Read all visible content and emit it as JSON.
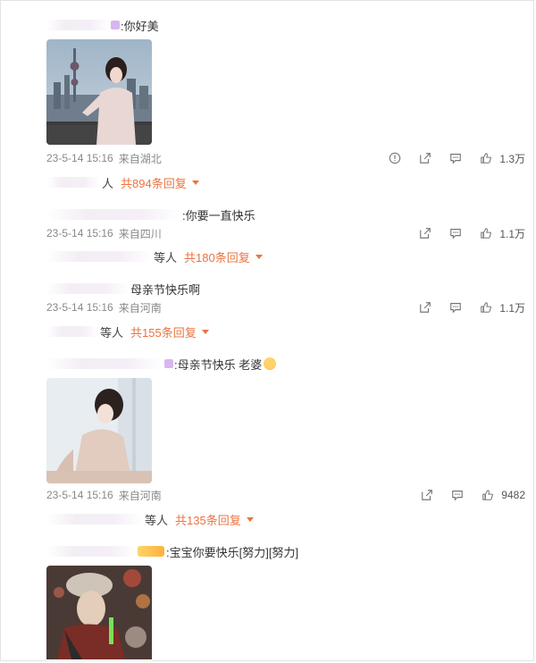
{
  "comments": [
    {
      "text": ":你好美",
      "time": "23-5-14 15:16",
      "location": "来自湖北",
      "likes": "1.3万",
      "reply_prefix": "人",
      "reply_count": "共894条回复"
    },
    {
      "text": ":你要一直快乐",
      "time": "23-5-14 15:16",
      "location": "来自四川",
      "likes": "1.1万",
      "reply_prefix": "等人",
      "reply_count": "共180条回复"
    },
    {
      "text": "母亲节快乐啊",
      "time": "23-5-14 15:16",
      "location": "来自河南",
      "likes": "1.1万",
      "reply_prefix": "等人",
      "reply_count": "共155条回复"
    },
    {
      "text": ":母亲节快乐 老婆",
      "time": "23-5-14 15:16",
      "location": "来自河南",
      "likes": "9482",
      "reply_prefix": "等人",
      "reply_count": "共135条回复"
    },
    {
      "text": ":宝宝你要快乐[努力][努力]"
    }
  ],
  "icons": {
    "report": "warning-icon",
    "share": "share-icon",
    "comment": "comment-icon",
    "like": "thumbs-up-icon"
  },
  "colors": {
    "accent": "#eb7340",
    "meta": "#888888",
    "text": "#333333"
  }
}
